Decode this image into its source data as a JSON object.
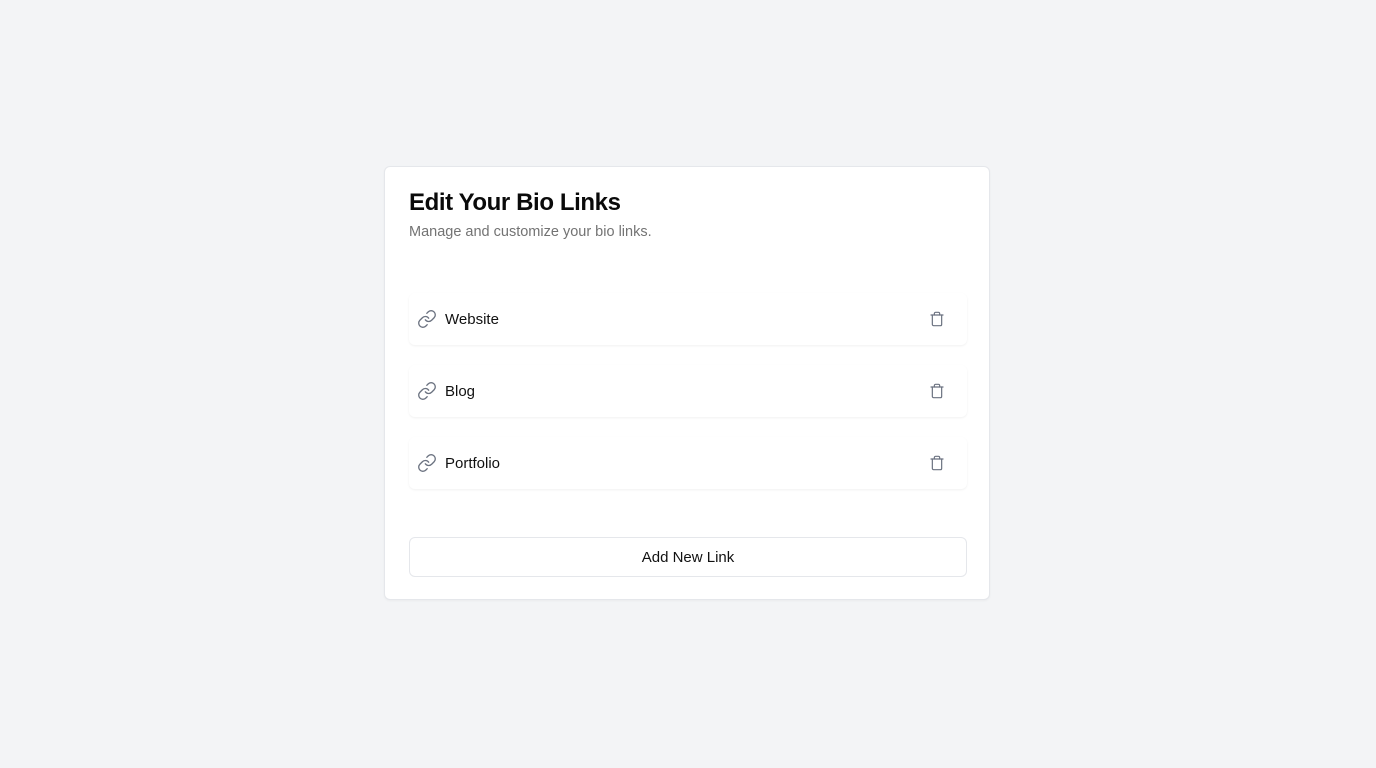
{
  "card": {
    "title": "Edit Your Bio Links",
    "subtitle": "Manage and customize your bio links."
  },
  "links": [
    {
      "label": "Website",
      "icon": "link-icon",
      "action_icon": "trash-icon"
    },
    {
      "label": "Blog",
      "icon": "link-icon",
      "action_icon": "trash-icon"
    },
    {
      "label": "Portfolio",
      "icon": "link-icon",
      "action_icon": "trash-icon"
    }
  ],
  "actions": {
    "add_label": "Add New Link"
  },
  "colors": {
    "background": "#f3f4f6",
    "card": "#ffffff",
    "border": "#e5e7eb",
    "muted_text": "#737373",
    "icon": "#6b7280"
  }
}
